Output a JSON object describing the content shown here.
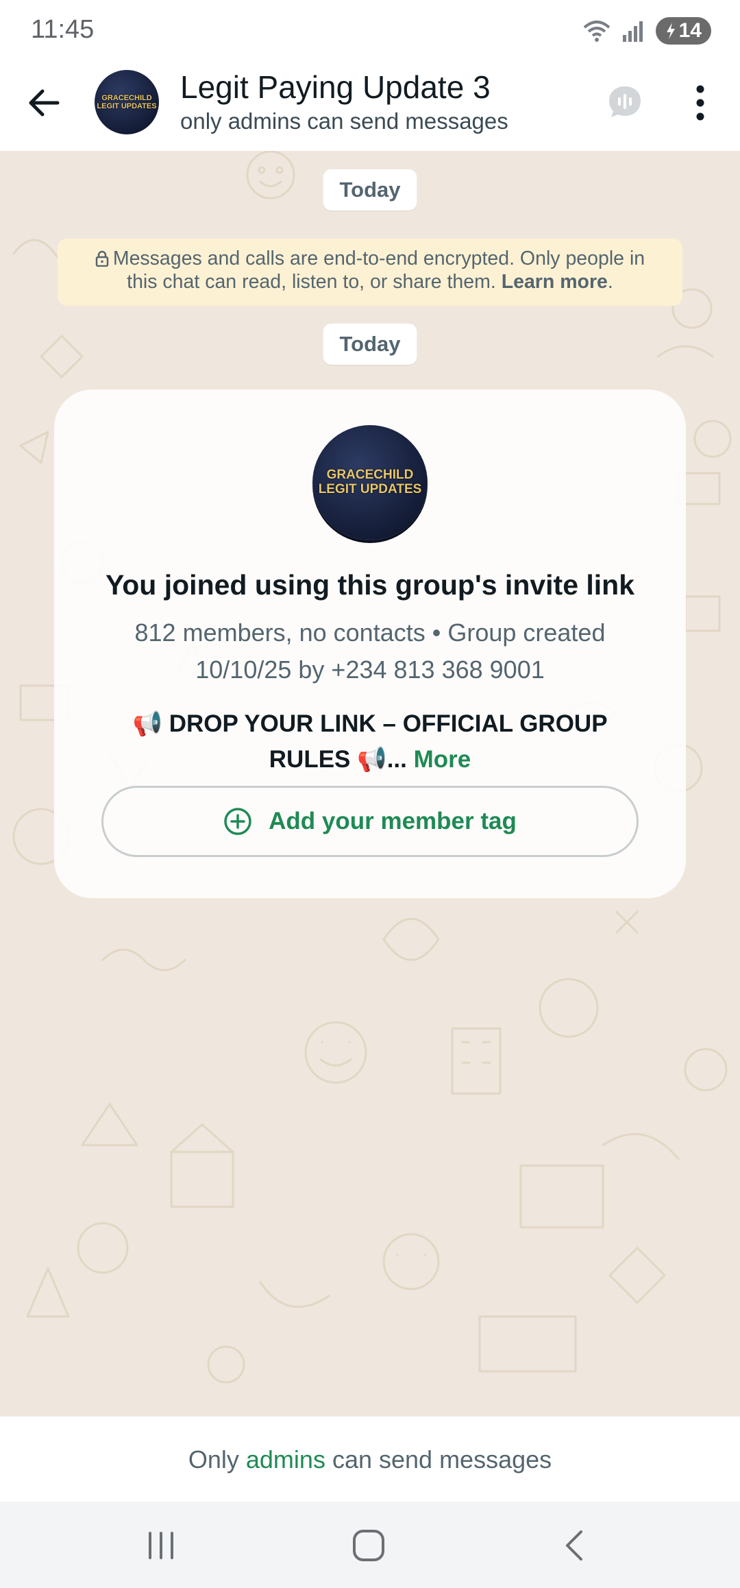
{
  "status_bar": {
    "time": "11:45",
    "battery": "14",
    "icons": [
      "wifi-icon",
      "signal-icon",
      "battery-charging-icon"
    ]
  },
  "header": {
    "title": "Legit Paying Update 3",
    "subtitle": "only admins can send messages",
    "avatar_text": [
      "GRACECHILD",
      "LEGIT UPDATES"
    ],
    "icons": [
      "back-arrow-icon",
      "group-call-icon",
      "more-vert-icon"
    ]
  },
  "chat": {
    "date_chips": [
      "Today",
      "Today"
    ],
    "encryption_notice": {
      "text": "Messages and calls are end-to-end encrypted. Only people in this chat can read, listen to, or share them.",
      "link": "Learn more",
      "end": "."
    },
    "system_card": {
      "avatar_text": [
        "GRACECHILD",
        "LEGIT UPDATES"
      ],
      "title": "You joined using this group's invite link",
      "meta_line1": "812 members, no contacts • Group created",
      "meta_line2": "10/10/25 by +234 813 368 9001",
      "description_line1": "📢 DROP YOUR LINK – OFFICIAL GROUP",
      "description_line2": "RULES 📢...",
      "more_label": "More",
      "tag_button_label": "Add your member tag"
    }
  },
  "footer": {
    "prefix": "Only",
    "link": "admins",
    "suffix": "can send messages"
  },
  "colors": {
    "accent_green": "#1f8a54",
    "chat_bg": "#efe7dd",
    "notice_bg": "#fdf1d3"
  }
}
